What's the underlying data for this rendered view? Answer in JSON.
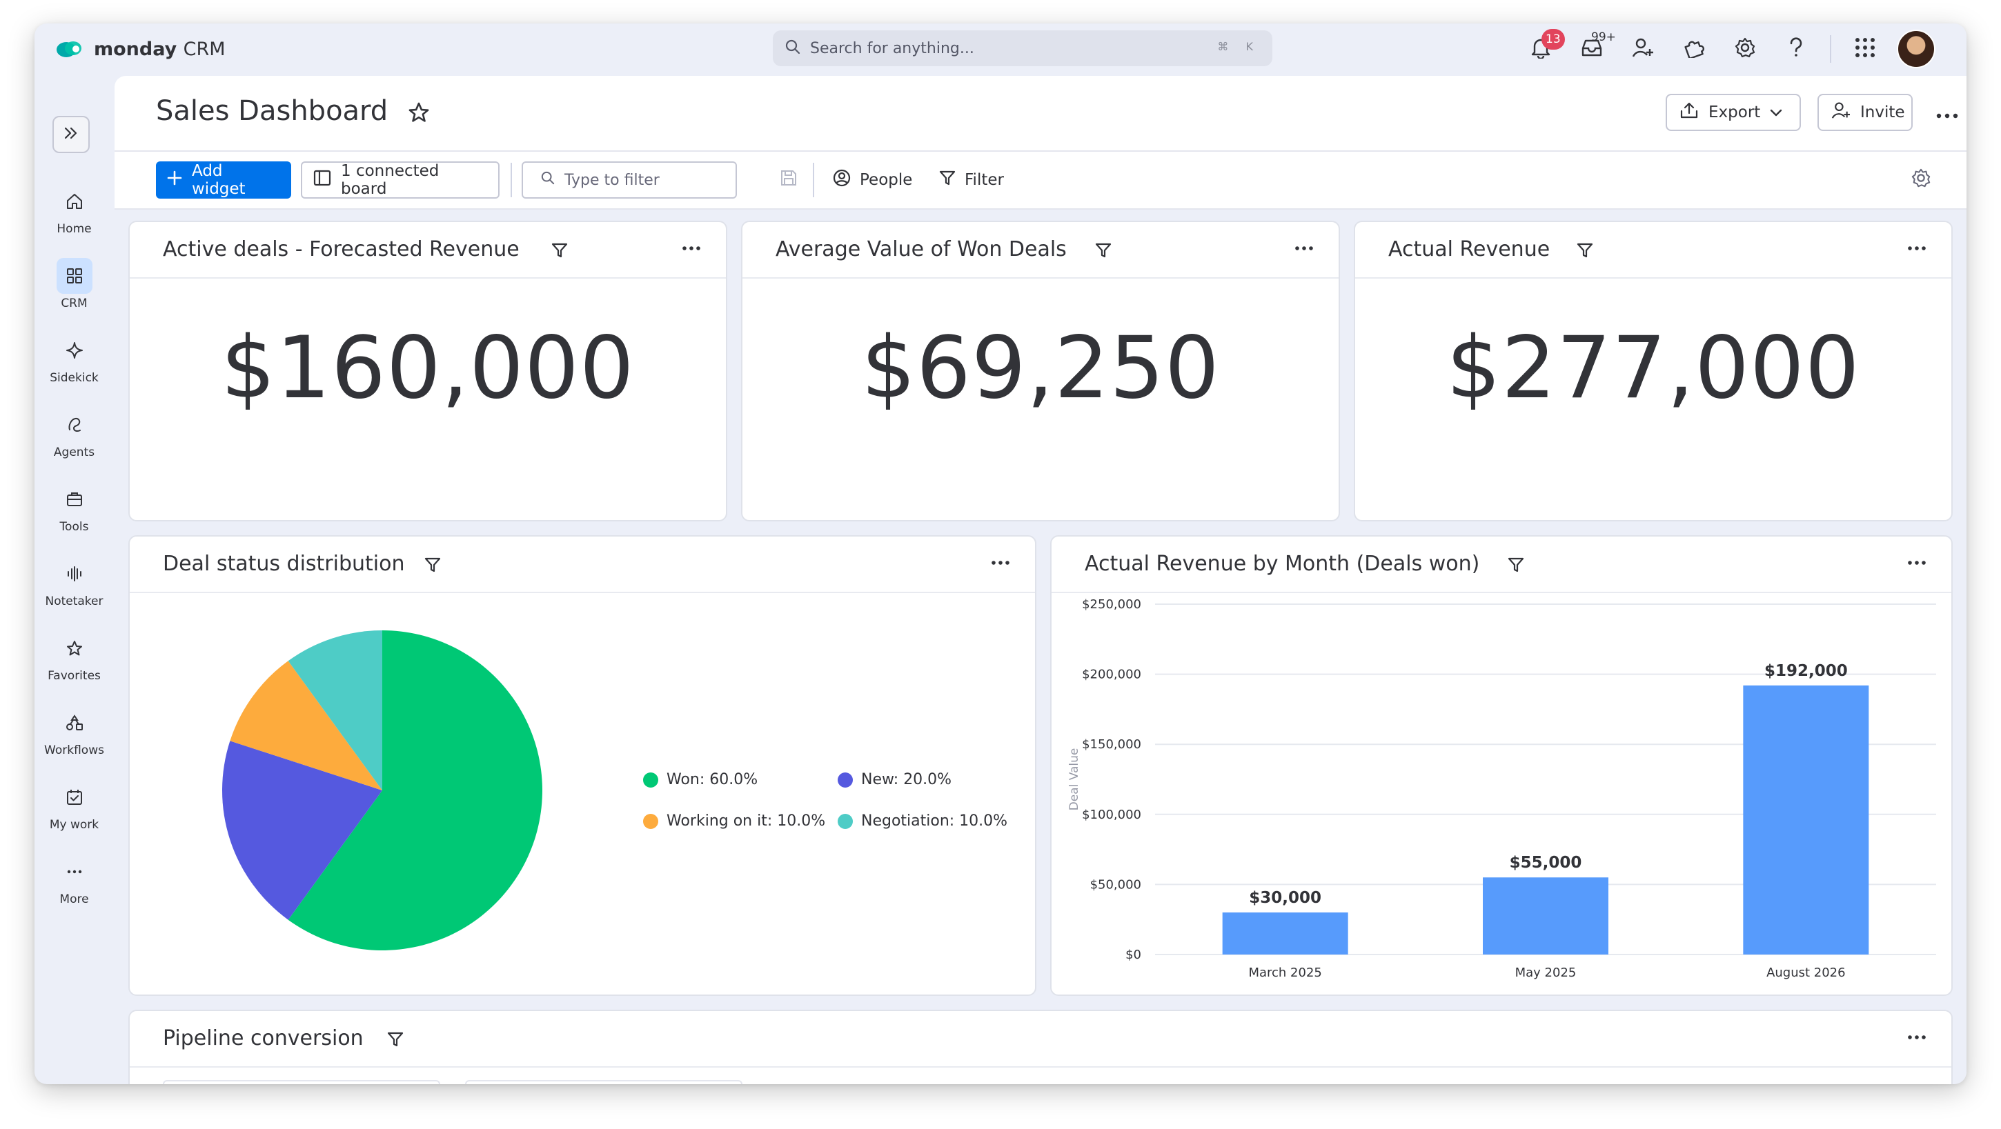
{
  "app": {
    "brand_bold": "monday",
    "brand_light": "CRM"
  },
  "search": {
    "placeholder": "Search for anything...",
    "shortcut": "⌘ K"
  },
  "topbar": {
    "notifications_count": "13",
    "inbox_count": "99+"
  },
  "rail": {
    "items": [
      {
        "label": "Home",
        "icon": "home-icon"
      },
      {
        "label": "CRM",
        "icon": "grid-icon",
        "active": true
      },
      {
        "label": "Sidekick",
        "icon": "sparkle-icon"
      },
      {
        "label": "Agents",
        "icon": "agent-icon"
      },
      {
        "label": "Tools",
        "icon": "briefcase-icon"
      },
      {
        "label": "Notetaker",
        "icon": "waveform-icon"
      },
      {
        "label": "Favorites",
        "icon": "star-icon"
      },
      {
        "label": "Workflows",
        "icon": "workflow-icon"
      },
      {
        "label": "My work",
        "icon": "calendar-check-icon"
      },
      {
        "label": "More",
        "icon": "more-icon"
      }
    ]
  },
  "header": {
    "title": "Sales Dashboard",
    "export_label": "Export",
    "invite_label": "Invite"
  },
  "toolbar": {
    "add_widget_label": "Add widget",
    "connected_board_label": "1 connected board",
    "filter_placeholder": "Type to filter",
    "people_label": "People",
    "filter_label": "Filter"
  },
  "widgets": {
    "forecast": {
      "title": "Active deals - Forecasted Revenue",
      "value": "$160,000"
    },
    "avg_won": {
      "title": "Average Value of Won Deals",
      "value": "$69,250"
    },
    "actual": {
      "title": "Actual Revenue",
      "value": "$277,000"
    },
    "status": {
      "title": "Deal status distribution",
      "legend": [
        {
          "label": "Won: 60.0%",
          "color": "#00c875"
        },
        {
          "label": "New: 20.0%",
          "color": "#5559df"
        },
        {
          "label": "Working on it: 10.0%",
          "color": "#fdab3d"
        },
        {
          "label": "Negotiation: 10.0%",
          "color": "#4eccc6"
        }
      ]
    },
    "by_month": {
      "title": "Actual Revenue by Month (Deals won)"
    },
    "pipeline": {
      "title": "Pipeline conversion"
    }
  },
  "chart_data": [
    {
      "type": "pie",
      "title": "Deal status distribution",
      "series": [
        {
          "name": "Won",
          "value": 60.0,
          "color": "#00c875"
        },
        {
          "name": "New",
          "value": 20.0,
          "color": "#5559df"
        },
        {
          "name": "Working on it",
          "value": 10.0,
          "color": "#fdab3d"
        },
        {
          "name": "Negotiation",
          "value": 10.0,
          "color": "#4eccc6"
        }
      ]
    },
    {
      "type": "bar",
      "title": "Actual Revenue by Month (Deals won)",
      "categories": [
        "March 2025",
        "May 2025",
        "August 2026"
      ],
      "values": [
        30000,
        55000,
        192000
      ],
      "value_labels": [
        "$30,000",
        "$55,000",
        "$192,000"
      ],
      "ylabel": "Deal Value",
      "ylim": [
        0,
        250000
      ],
      "yticks": [
        0,
        50000,
        100000,
        150000,
        200000,
        250000
      ],
      "ytick_labels": [
        "$0",
        "$50,000",
        "$100,000",
        "$150,000",
        "$200,000",
        "$250,000"
      ],
      "bar_color": "#579bfc",
      "grid": true
    }
  ]
}
